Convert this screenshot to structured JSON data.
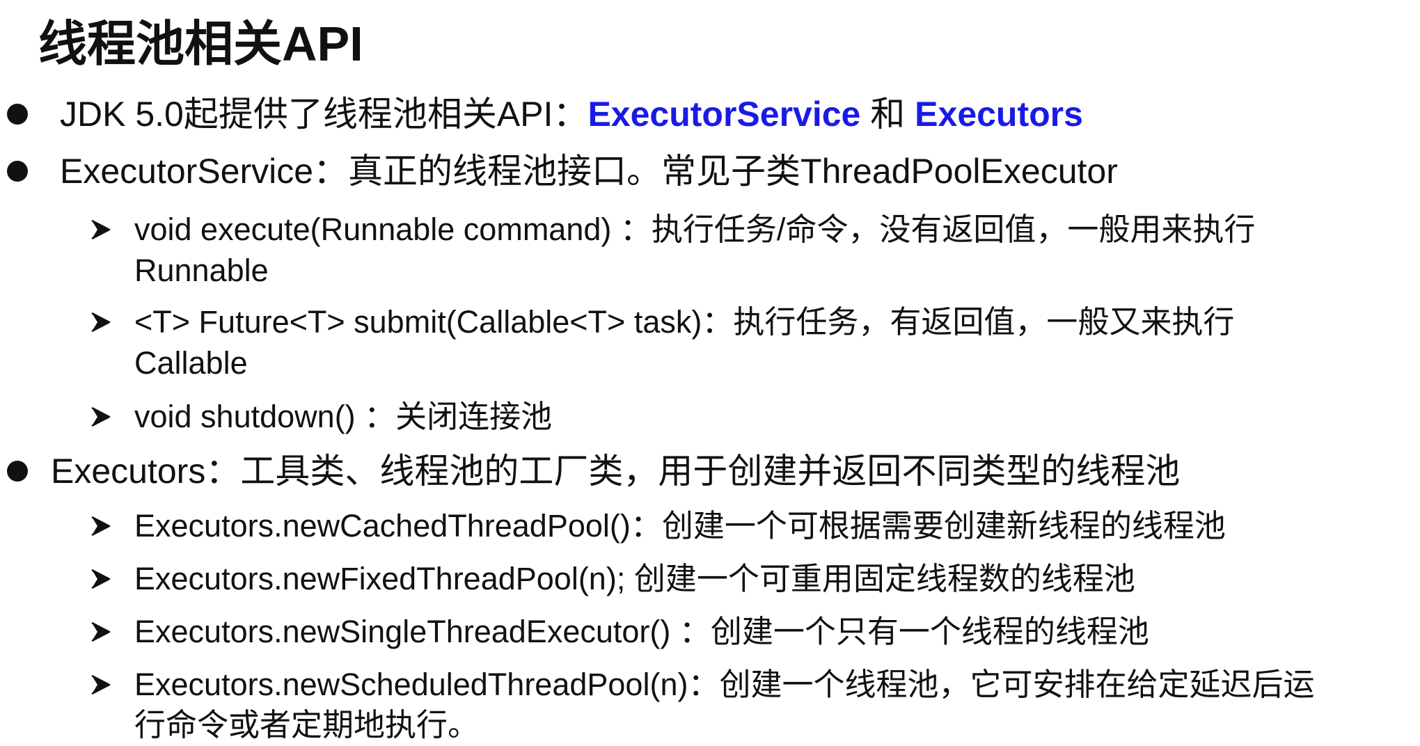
{
  "title": "线程池相关API",
  "bullets": {
    "b1": {
      "prefix": "JDK 5.0起提供了线程池相关API：",
      "term1": "ExecutorService",
      "mid": " 和 ",
      "term2": "Executors"
    },
    "b2": {
      "text": "ExecutorService：真正的线程池接口。常见子类ThreadPoolExecutor",
      "items": [
        {
          "line1": "void execute(Runnable command) ：执行任务/命令，没有返回值，一般用来执行",
          "line2": "Runnable"
        },
        {
          "line1": "<T> Future<T> submit(Callable<T> task)：执行任务，有返回值，一般又来执行",
          "line2": "Callable"
        },
        {
          "line1": "void shutdown() ：关闭连接池"
        }
      ]
    },
    "b3": {
      "text": "Executors：工具类、线程池的工厂类，用于创建并返回不同类型的线程池",
      "items": [
        {
          "line1": "Executors.newCachedThreadPool()：创建一个可根据需要创建新线程的线程池"
        },
        {
          "line1": "Executors.newFixedThreadPool(n); 创建一个可重用固定线程数的线程池"
        },
        {
          "line1": "Executors.newSingleThreadExecutor() ：创建一个只有一个线程的线程池"
        },
        {
          "line1": "Executors.newScheduledThreadPool(n)：创建一个线程池，它可安排在给定延迟后运",
          "line2": "行命令或者定期地执行。"
        }
      ]
    }
  },
  "icons": {
    "bullet": "filled-circle-bullet",
    "sub_bullet": "arrowhead-bullet"
  },
  "colors": {
    "text": "#111111",
    "highlight": "#1a1ae6"
  }
}
